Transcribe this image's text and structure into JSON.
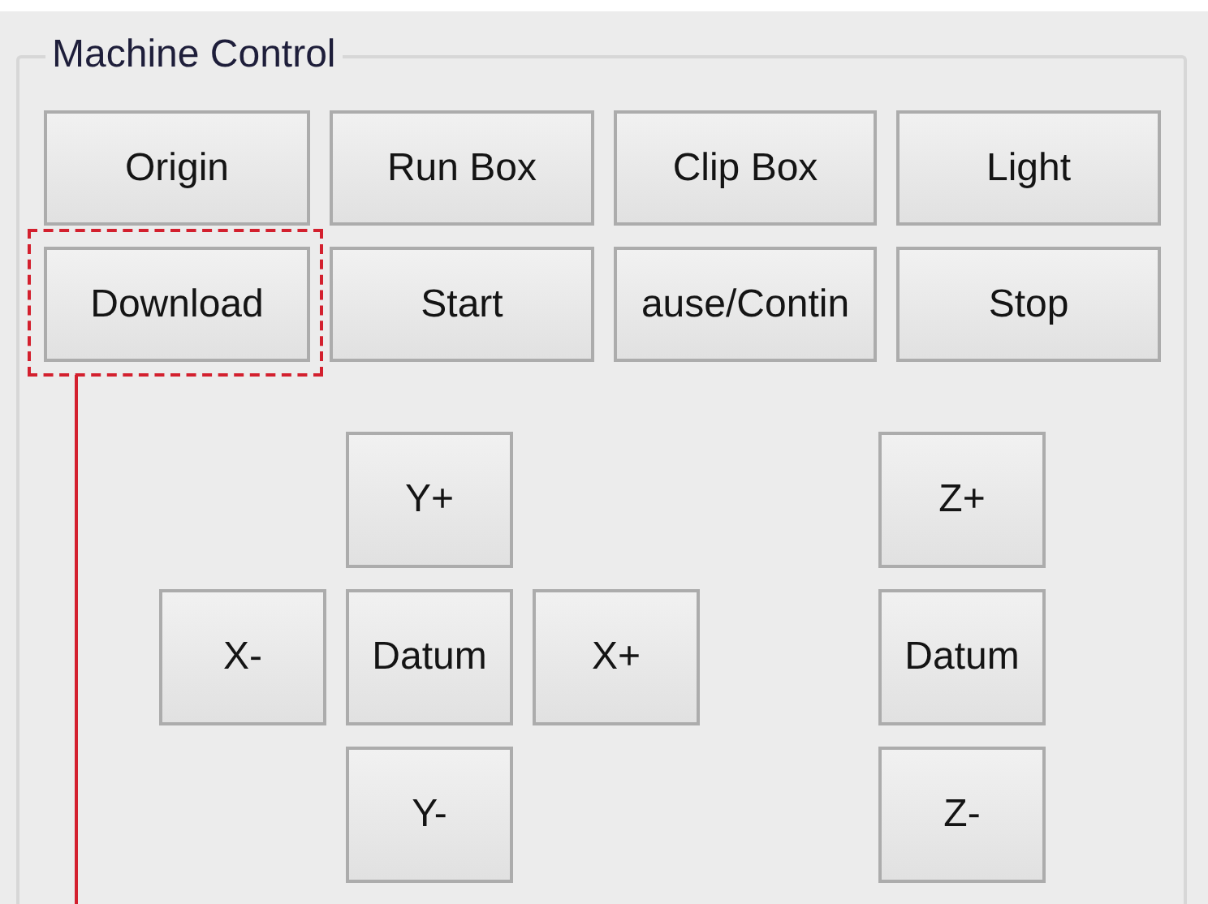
{
  "group": {
    "title": "Machine Control"
  },
  "buttons": [
    {
      "label": "Origin",
      "highlighted": false
    },
    {
      "label": "Run Box",
      "highlighted": false
    },
    {
      "label": "Clip Box",
      "highlighted": false
    },
    {
      "label": "Light",
      "highlighted": false
    },
    {
      "label": "Download",
      "highlighted": true
    },
    {
      "label": "Start",
      "highlighted": false
    },
    {
      "label": "ause/Contin",
      "highlighted": false
    },
    {
      "label": "Stop",
      "highlighted": false
    }
  ],
  "xy_pad": [
    "Y+",
    "X-",
    "Datum",
    "X+",
    "Y-"
  ],
  "z_pad": [
    "Z+",
    "Datum",
    "Z-"
  ]
}
